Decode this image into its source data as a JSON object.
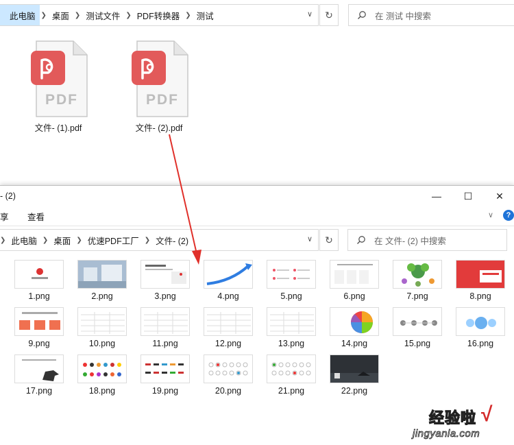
{
  "back_window": {
    "breadcrumb": [
      "此电脑",
      "桌面",
      "测试文件",
      "PDF转换器",
      "测试"
    ],
    "search_placeholder": "在 测试 中搜索",
    "files": [
      {
        "name": "文件- (1).pdf",
        "badge": "PDF"
      },
      {
        "name": "文件- (2).pdf",
        "badge": "PDF"
      }
    ]
  },
  "front_window": {
    "title": "- (2)",
    "ribbon_tabs": [
      "享",
      "查看"
    ],
    "breadcrumb": [
      "此电脑",
      "桌面",
      "优速PDF工厂",
      "文件- (2)"
    ],
    "search_placeholder": "在 文件- (2) 中搜索",
    "help_label": "?",
    "window_buttons": [
      "—",
      "☐",
      "✕"
    ],
    "files": [
      "1.png",
      "2.png",
      "3.png",
      "4.png",
      "5.png",
      "6.png",
      "7.png",
      "8.png",
      "9.png",
      "10.png",
      "11.png",
      "12.png",
      "13.png",
      "14.png",
      "15.png",
      "16.png",
      "17.png",
      "18.png",
      "19.png",
      "20.png",
      "21.png",
      "22.png"
    ]
  },
  "watermark": {
    "main": "经验啦",
    "check": "√",
    "sub": "jingyanla.com"
  },
  "colors": {
    "pdf_red": "#e25a5a",
    "selection": "#cce8ff",
    "arrow": "#e0302a",
    "help_blue": "#1e73d8"
  },
  "icons": {
    "search": "search-icon",
    "refresh": "refresh-icon",
    "chevron": "chevron-right-icon",
    "dropdown": "chevron-down-icon"
  }
}
